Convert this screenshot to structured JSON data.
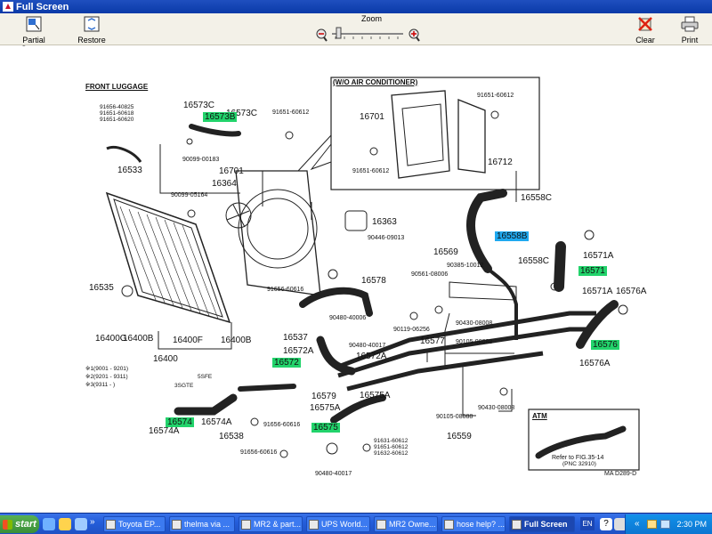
{
  "window": {
    "title": "Full Screen"
  },
  "toolbar": {
    "partial_screen": "Partial Screen",
    "restore": "Restore",
    "zoom": "Zoom",
    "clear": "Clear",
    "print": "Print"
  },
  "diagram": {
    "front_luggage": "FRONT LUGGAGE",
    "wo_ac": "(W/O AIR CONDITIONER)",
    "labels": {
      "l16573C_a": "16573C",
      "l16573C_b": "16573C",
      "l16573B": "16573B",
      "l91651_60612_top": "91651-60612",
      "l91656_40825": "91656-40825",
      "l91651_60618": "91651-60618",
      "l91651_60620": "91651-60620",
      "l16533": "16533",
      "l90099_00183": "90099-00183",
      "l16701": "16701",
      "l16364": "16364",
      "l90099_05164": "90099-05164",
      "l16363": "16363",
      "l90446_09013": "90446-09013",
      "l91656_60616_a": "91656-60616",
      "l16535": "16535",
      "l16578": "16578",
      "l16400G": "16400G",
      "l16400B_a": "16400B",
      "l16400F": "16400F",
      "l16400B_b": "16400B",
      "l16400": "16400",
      "l90480_40006": "90480-40006",
      "l90480_40017_a": "90480-40017",
      "l16537": "16537",
      "l16572A_a": "16572A",
      "l16572": "16572",
      "l16572A_b": "16572A",
      "l16579": "16579",
      "l16575A_a": "16575A",
      "l16575A_b": "16575A",
      "l16575": "16575",
      "l16574": "16574",
      "l16574A_a": "16574A",
      "l16574A_b": "16574A",
      "l16538": "16538",
      "l91656_60616_b": "91656-60616",
      "l91656_60616_c": "91656-60616",
      "l90480_40017_b": "90480-40017",
      "l91631_60612": "91631-60612",
      "l91651_60612_b": "91651-60612",
      "l91632_60612": "91632-60612",
      "l16559": "16559",
      "l90105_08088_a": "90105-08088",
      "l90430_08008_a": "90430-08008",
      "l90430_08008_b": "90430-08008",
      "l90105_08088_b": "90105-08088",
      "l16577": "16577",
      "l90119_06256": "90119-06256",
      "l16569": "16569",
      "l90385_10012": "90385-10012",
      "l90561_08006": "90561-08006",
      "l16558C_a": "16558C",
      "l16558B": "16558B",
      "l16558C_b": "16558C",
      "l16571A_a": "16571A",
      "l16571": "16571",
      "l16571A_b": "16571A",
      "l16576A_a": "16576A",
      "l16576": "16576",
      "l16576A_b": "16576A",
      "l16701_ac": "16701",
      "l91651_60612_ac_a": "91651-60612",
      "l91651_60612_ac_b": "91651-60612",
      "l16712": "16712",
      "atm": "ATM",
      "refer": "Refer to FIG.35-14",
      "pnc": "(PNC 32910)",
      "ma": "MA D289-D",
      "footnote1": "※1(9001 - 9201)",
      "footnote2": "※2(9201 - 9311)",
      "footnote3": "※3(9311 -        )",
      "fn_5sfe": "5SFE",
      "fn_3sgte": "3SGTE"
    }
  },
  "taskbar": {
    "start": "start",
    "items": [
      "Toyota EP...",
      "thelma via ...",
      "MR2 & part...",
      "UPS World...",
      "MR2 Owne...",
      "hose help? ...",
      "Full Screen"
    ],
    "lang": "EN",
    "time": "2:30 PM"
  },
  "colors": {
    "highlight_green": "#22d36b",
    "highlight_blue": "#1fa9f0",
    "titlebar": "#0a3aa8",
    "taskbar": "#245edb"
  }
}
